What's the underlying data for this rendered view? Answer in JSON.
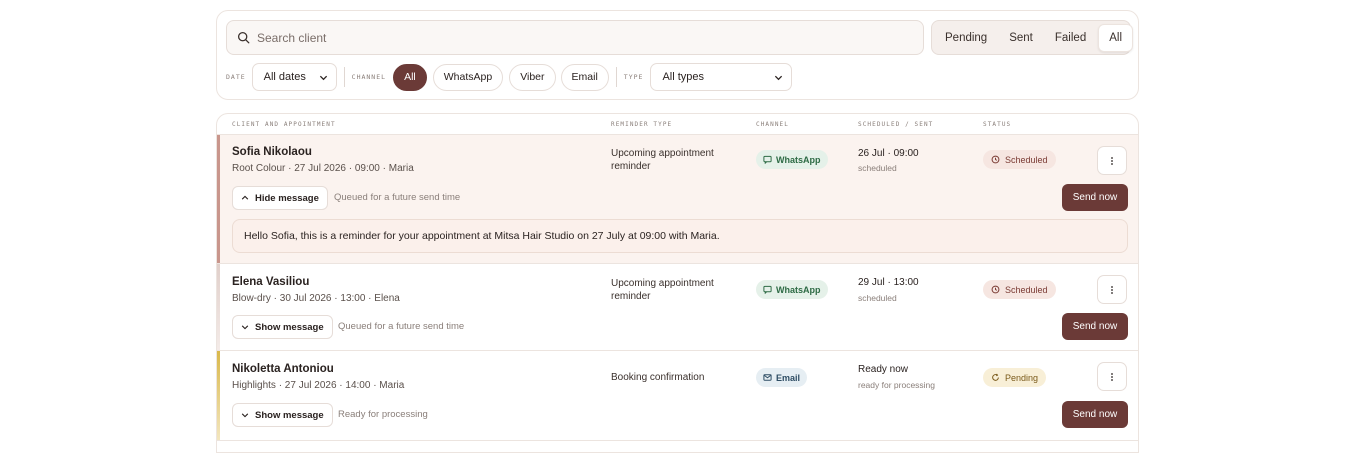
{
  "search": {
    "placeholder": "Search client"
  },
  "status_tabs": [
    {
      "label": "Pending"
    },
    {
      "label": "Sent"
    },
    {
      "label": "Failed"
    },
    {
      "label": "All"
    }
  ],
  "filters": {
    "date_label": "DATE",
    "date_value": "All dates",
    "channel_label": "CHANNEL",
    "channels": [
      "All",
      "WhatsApp",
      "Viber",
      "Email"
    ],
    "type_label": "TYPE",
    "type_value": "All types"
  },
  "table": {
    "headers": {
      "client": "CLIENT AND APPOINTMENT",
      "reminder": "REMINDER TYPE",
      "channel": "CHANNEL",
      "scheduled": "SCHEDULED / SENT",
      "status": "STATUS"
    },
    "rows": [
      {
        "name": "Sofia Nikolaou",
        "appointment": "Root Colour · 27 Jul 2026 · 09:00 · Maria",
        "reminder_line1": "Upcoming appointment",
        "reminder_line2": "reminder",
        "channel": "WhatsApp",
        "scheduled": "26 Jul · 09:00",
        "scheduled_sub": "scheduled",
        "status": "Scheduled",
        "toggle": "Hide message",
        "note": "Queued for a future send time",
        "send": "Send now",
        "message": "Hello Sofia, this is a reminder for your appointment at Mitsa Hair Studio on 27 July at 09:00 with Maria."
      },
      {
        "name": "Elena Vasiliou",
        "appointment": "Blow-dry · 30 Jul 2026 · 13:00 · Elena",
        "reminder_line1": "Upcoming appointment",
        "reminder_line2": "reminder",
        "channel": "WhatsApp",
        "scheduled": "29 Jul · 13:00",
        "scheduled_sub": "scheduled",
        "status": "Scheduled",
        "toggle": "Show message",
        "note": "Queued for a future send time",
        "send": "Send now"
      },
      {
        "name": "Nikoletta Antoniou",
        "appointment": "Highlights · 27 Jul 2026 · 14:00 · Maria",
        "reminder_line1": "Booking confirmation",
        "channel": "Email",
        "scheduled": "Ready now",
        "scheduled_sub": "ready for processing",
        "status": "Pending",
        "toggle": "Show message",
        "note": "Ready for processing",
        "send": "Send now"
      }
    ]
  },
  "colors": {
    "accent": "#6b3a37",
    "whatsapp_bg": "#e5f1e9",
    "whatsapp_fg": "#2e6b45",
    "email_bg": "#e6eef3",
    "email_fg": "#2e4d64",
    "scheduled_bg": "#f6e6e1",
    "scheduled_fg": "#7a3a33",
    "pending_bg": "#f8efd7",
    "pending_fg": "#7a5a1a"
  },
  "icons": [
    "search-icon",
    "chevron-down-icon",
    "chevron-up-icon",
    "message-icon",
    "mail-icon",
    "clock-icon",
    "refresh-icon",
    "kebab-icon"
  ]
}
